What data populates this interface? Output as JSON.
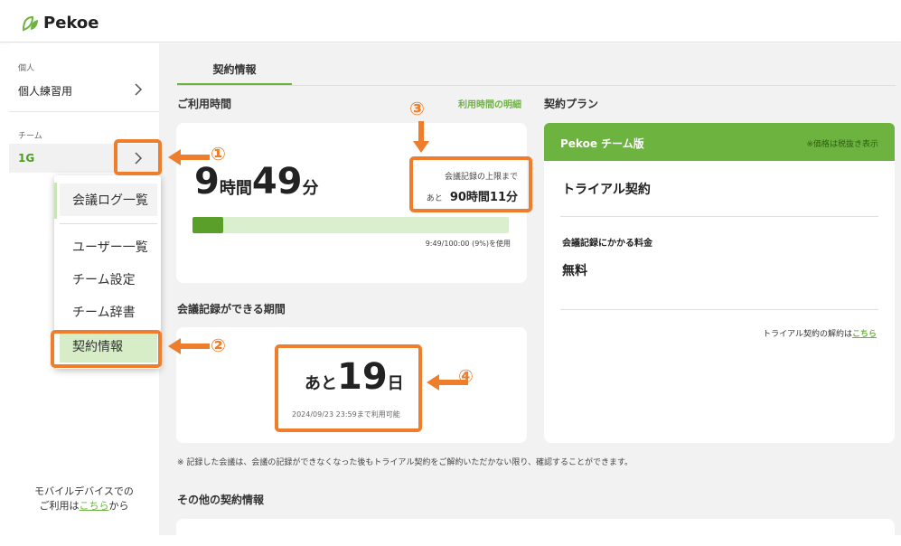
{
  "app": {
    "logo_text": "Pekoe"
  },
  "sidebar": {
    "section_personal": "個人",
    "personal_item": "個人練習用",
    "section_team": "チーム",
    "team_item": "1G",
    "mobile_line1": "モバイルデバイスでの",
    "mobile_line2_prefix": "ご利用は",
    "mobile_link": "こちら",
    "mobile_line2_suffix": "から"
  },
  "popup": {
    "items": [
      "会議ログ一覧",
      "ユーザー一覧",
      "チーム設定",
      "チーム辞書",
      "契約情報"
    ]
  },
  "main": {
    "tab_label": "契約情報",
    "usage": {
      "title": "ご利用時間",
      "detail_link": "利用時間の明細",
      "hours": "9",
      "hours_unit": "時間",
      "minutes": "49",
      "minutes_unit": "分",
      "limit_label": "会議記録の上限まで",
      "remaining_prefix": "あと",
      "remaining_value": "90時間11分",
      "usage_text": "9:49/100:00 (9%)を使用",
      "progress_fraction": 0.098
    },
    "period": {
      "title": "会議記録ができる期間",
      "prefix": "あと",
      "days": "19",
      "days_unit": "日",
      "until": "2024/09/23 23:59まで利用可能"
    },
    "plan": {
      "title": "契約プラン",
      "plan_name": "Pekoe チーム版",
      "tax_note": "※価格は税抜き表示",
      "contract_type": "トライアル契約",
      "fee_label": "会議記録にかかる料金",
      "fee_value": "無料",
      "cancel_prefix": "トライアル契約の解約は",
      "cancel_link": "こちら"
    },
    "note": "※ 記録した会議は、会議の記録ができなくなった後もトライアル契約をご解約いただかない限り、確認することができます。",
    "other_title": "その他の契約情報"
  },
  "annotations": {
    "n1": "①",
    "n2": "②",
    "n3": "③",
    "n4": "④"
  },
  "colors": {
    "accent": "#6cb33f",
    "annotation": "#ee7d2c"
  }
}
